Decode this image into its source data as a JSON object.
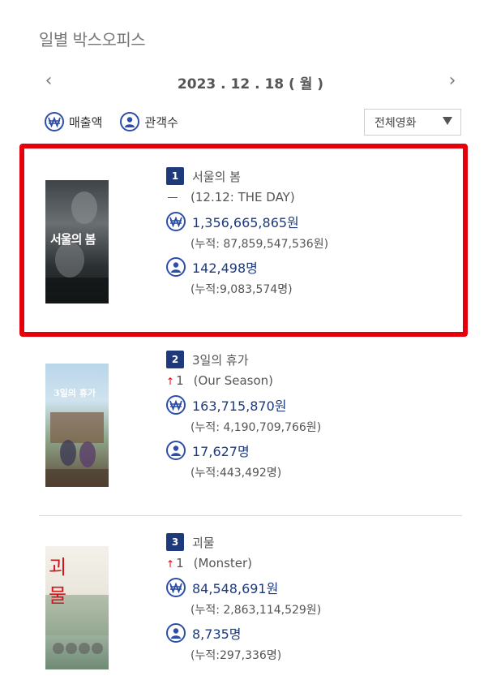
{
  "page_title": "일별 박스오피스",
  "date_nav": {
    "prev": "‹",
    "date": "2023 . 12 . 18 ( 월 )",
    "next": "›"
  },
  "legend": {
    "sales_label": "매출액",
    "audience_label": "관객수"
  },
  "filter_select": {
    "value": "전체영화"
  },
  "colors": {
    "accent": "#1e3a7b",
    "icon": "#2c4ea8",
    "highlight": "#e6000b",
    "up": "#e6000b"
  },
  "movies": [
    {
      "rank": "1",
      "title": "서울의 봄",
      "change": "",
      "change_direction": "none",
      "title_en": "(12.12: THE DAY)",
      "sales": "1,356,665,865원",
      "sales_cum": "(누적: 87,859,547,536원)",
      "audience": "142,498명",
      "audience_cum": "(누적:9,083,574명)",
      "poster_text": "서울의 봄",
      "highlighted": true
    },
    {
      "rank": "2",
      "title": "3일의 휴가",
      "change": "1",
      "change_direction": "up",
      "title_en": "(Our Season)",
      "sales": "163,715,870원",
      "sales_cum": "(누적: 4,190,709,766원)",
      "audience": "17,627명",
      "audience_cum": "(누적:443,492명)",
      "poster_text": "3일의 휴가",
      "highlighted": false
    },
    {
      "rank": "3",
      "title": "괴물",
      "change": "1",
      "change_direction": "up",
      "title_en": "(Monster)",
      "sales": "84,548,691원",
      "sales_cum": "(누적: 2,863,114,529원)",
      "audience": "8,735명",
      "audience_cum": "(누적:297,336명)",
      "poster_text": "괴 물",
      "highlighted": false
    }
  ]
}
